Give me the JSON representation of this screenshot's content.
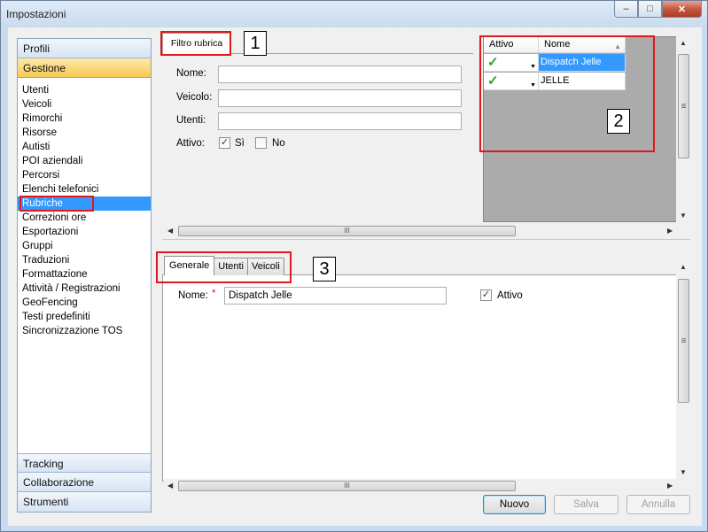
{
  "window": {
    "title": "Impostazioni",
    "min": "–",
    "max": "□",
    "close": "✕"
  },
  "nav": {
    "profili": "Profili",
    "gestione": "Gestione",
    "items": [
      "Utenti",
      "Veicoli",
      "Rimorchi",
      "Risorse",
      "Autisti",
      "POI aziendali",
      "Percorsi",
      "Elenchi telefonici",
      "Rubriche",
      "Correzioni ore",
      "Esportazioni",
      "Gruppi",
      "Traduzioni",
      "Formattazione",
      "Attività / Registrazioni",
      "GeoFencing",
      "Testi predefiniti",
      "Sincronizzazione TOS"
    ],
    "tracking": "Tracking",
    "collaborazione": "Collaborazione",
    "strumenti": "Strumenti"
  },
  "filter": {
    "tab": "Filtro rubrica",
    "nome_label": "Nome:",
    "veicolo_label": "Veicolo:",
    "utenti_label": "Utenti:",
    "attivo_label": "Attivo:",
    "si_label": "Sì",
    "no_label": "No",
    "nome_value": "",
    "veicolo_value": "",
    "utenti_value": ""
  },
  "grid": {
    "col_attivo": "Attivo",
    "col_nome": "Nome",
    "rows": [
      {
        "nome": "Dispatch Jelle"
      },
      {
        "nome": "JELLE"
      }
    ]
  },
  "tabs": {
    "generale": "Generale",
    "utenti": "Utenti",
    "veicoli": "Veicoli"
  },
  "detail": {
    "nome_label": "Nome:",
    "required": "*",
    "nome_value": "Dispatch Jelle",
    "attivo_label": "Attivo"
  },
  "buttons": {
    "nuovo": "Nuovo",
    "salva": "Salva",
    "annulla": "Annulla"
  },
  "callouts": {
    "one": "1",
    "two": "2",
    "three": "3"
  },
  "colors": {
    "accent": "#3399ff",
    "highlight": "#e0181b",
    "nav_active": "#f8c955"
  },
  "scroll": {
    "grip": "≡",
    "hgrip": "III"
  }
}
